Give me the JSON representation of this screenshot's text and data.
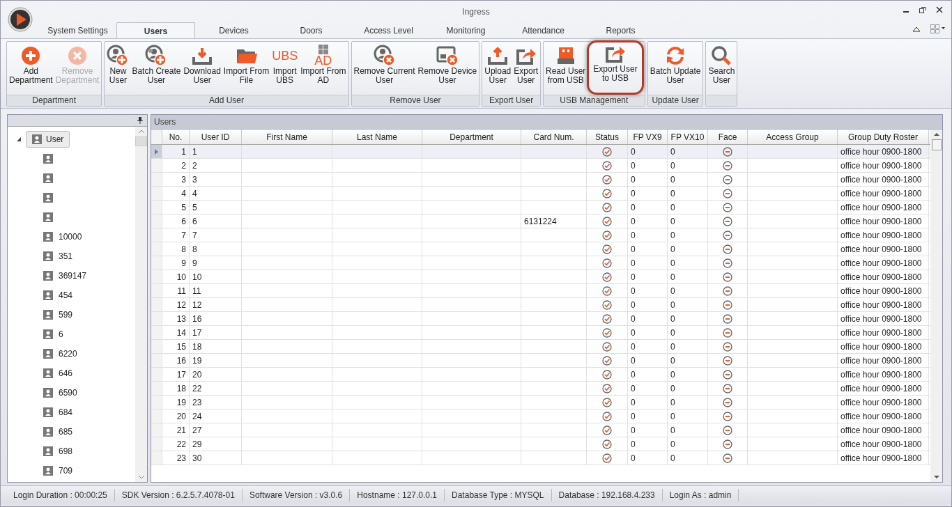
{
  "window": {
    "title": "Ingress"
  },
  "tabs": [
    {
      "label": "System Settings",
      "selected": false
    },
    {
      "label": "Users",
      "selected": true
    },
    {
      "label": "Devices",
      "selected": false
    },
    {
      "label": "Doors",
      "selected": false
    },
    {
      "label": "Access Level",
      "selected": false
    },
    {
      "label": "Monitoring",
      "selected": false
    },
    {
      "label": "Attendance",
      "selected": false
    },
    {
      "label": "Reports",
      "selected": false
    }
  ],
  "ribbon": {
    "groups": [
      {
        "title": "Department",
        "buttons": [
          {
            "label": "Add\nDepartment",
            "kind": "add",
            "disabled": false,
            "highlighted": false
          },
          {
            "label": "Remove\nDepartment",
            "kind": "remove",
            "disabled": true,
            "highlighted": false
          }
        ]
      },
      {
        "title": "Add User",
        "buttons": [
          {
            "label": "New\nUser",
            "kind": "user-add",
            "disabled": false,
            "highlighted": false
          },
          {
            "label": "Batch Create\nUser",
            "kind": "users-add",
            "disabled": false,
            "highlighted": false
          },
          {
            "label": "Download\nUser",
            "kind": "download",
            "disabled": false,
            "highlighted": false
          },
          {
            "label": "Import From\nFile",
            "kind": "folder",
            "disabled": false,
            "highlighted": false
          },
          {
            "label": "Import\nUBS",
            "kind": "text",
            "icon_text": "UBS",
            "disabled": false,
            "highlighted": false
          },
          {
            "label": "Import From\nAD",
            "kind": "windows-text",
            "icon_text": "AD",
            "disabled": false,
            "highlighted": false
          }
        ]
      },
      {
        "title": "Remove User",
        "buttons": [
          {
            "label": "Remove Current\nUser",
            "kind": "user-remove",
            "disabled": false,
            "highlighted": false
          },
          {
            "label": "Remove Device\nUser",
            "kind": "device-remove",
            "disabled": false,
            "highlighted": false
          }
        ]
      },
      {
        "title": "Export User",
        "buttons": [
          {
            "label": "Upload\nUser",
            "kind": "upload",
            "disabled": false,
            "highlighted": false
          },
          {
            "label": "Export\nUser",
            "kind": "export",
            "disabled": false,
            "highlighted": false
          }
        ]
      },
      {
        "title": "USB Management",
        "buttons": [
          {
            "label": "Read User\nfrom USB",
            "kind": "usb",
            "disabled": false,
            "highlighted": false
          },
          {
            "label": "Export User\nto USB",
            "kind": "export",
            "disabled": false,
            "highlighted": true
          }
        ]
      },
      {
        "title": "Update User",
        "buttons": [
          {
            "label": "Batch Update\nUser",
            "kind": "refresh",
            "disabled": false,
            "highlighted": false
          }
        ]
      },
      {
        "buttons": [
          {
            "label": "Search\nUser",
            "kind": "search",
            "disabled": false,
            "highlighted": false
          }
        ]
      }
    ]
  },
  "tree": {
    "label": "User",
    "expanded": true,
    "selected": true,
    "children": [
      {
        "kind": "user"
      },
      {
        "kind": "user"
      },
      {
        "kind": "user"
      },
      {
        "kind": "user"
      },
      {
        "kind": "user",
        "label": "10000"
      },
      {
        "kind": "user",
        "label": "351"
      },
      {
        "kind": "user",
        "label": "369147"
      },
      {
        "kind": "user",
        "label": "454"
      },
      {
        "kind": "user",
        "label": "599"
      },
      {
        "kind": "user",
        "label": "6"
      },
      {
        "kind": "user",
        "label": "6220"
      },
      {
        "kind": "user",
        "label": "646"
      },
      {
        "kind": "user",
        "label": "6590"
      },
      {
        "kind": "user",
        "label": "684"
      },
      {
        "kind": "user",
        "label": "685"
      },
      {
        "kind": "user",
        "label": "698"
      },
      {
        "kind": "user",
        "label": "709"
      }
    ]
  },
  "grid": {
    "title": "Users",
    "columns": [
      "No.",
      "User ID",
      "First Name",
      "Last Name",
      "Department",
      "Card Num.",
      "Status",
      "FP VX9",
      "FP VX10",
      "Face",
      "Access Group",
      "Group Duty Roster"
    ],
    "rows": [
      {
        "no": "1",
        "user_id": "1",
        "status_ok": true,
        "fp_vx9": "0",
        "fp_vx10": "0",
        "face_enrolled": false,
        "roster": "office hour 0900-1800",
        "selected": true
      },
      {
        "no": "2",
        "user_id": "2",
        "status_ok": true,
        "fp_vx9": "0",
        "fp_vx10": "0",
        "face_enrolled": false,
        "roster": "office hour 0900-1800",
        "selected": false
      },
      {
        "no": "3",
        "user_id": "3",
        "status_ok": true,
        "fp_vx9": "0",
        "fp_vx10": "0",
        "face_enrolled": false,
        "roster": "office hour 0900-1800",
        "selected": false
      },
      {
        "no": "4",
        "user_id": "4",
        "status_ok": true,
        "fp_vx9": "0",
        "fp_vx10": "0",
        "face_enrolled": false,
        "roster": "office hour 0900-1800",
        "selected": false
      },
      {
        "no": "5",
        "user_id": "5",
        "status_ok": true,
        "fp_vx9": "0",
        "fp_vx10": "0",
        "face_enrolled": false,
        "roster": "office hour 0900-1800",
        "selected": false
      },
      {
        "no": "6",
        "user_id": "6",
        "card": "6131224",
        "status_ok": true,
        "fp_vx9": "0",
        "fp_vx10": "0",
        "face_enrolled": false,
        "roster": "office hour 0900-1800",
        "selected": false
      },
      {
        "no": "7",
        "user_id": "7",
        "status_ok": true,
        "fp_vx9": "0",
        "fp_vx10": "0",
        "face_enrolled": false,
        "roster": "office hour 0900-1800",
        "selected": false
      },
      {
        "no": "8",
        "user_id": "8",
        "status_ok": true,
        "fp_vx9": "0",
        "fp_vx10": "0",
        "face_enrolled": false,
        "roster": "office hour 0900-1800",
        "selected": false
      },
      {
        "no": "9",
        "user_id": "9",
        "status_ok": true,
        "fp_vx9": "0",
        "fp_vx10": "0",
        "face_enrolled": false,
        "roster": "office hour 0900-1800",
        "selected": false
      },
      {
        "no": "10",
        "user_id": "10",
        "status_ok": true,
        "fp_vx9": "0",
        "fp_vx10": "0",
        "face_enrolled": false,
        "roster": "office hour 0900-1800",
        "selected": false
      },
      {
        "no": "11",
        "user_id": "11",
        "status_ok": true,
        "fp_vx9": "0",
        "fp_vx10": "0",
        "face_enrolled": false,
        "roster": "office hour 0900-1800",
        "selected": false
      },
      {
        "no": "12",
        "user_id": "12",
        "status_ok": true,
        "fp_vx9": "0",
        "fp_vx10": "0",
        "face_enrolled": false,
        "roster": "office hour 0900-1800",
        "selected": false
      },
      {
        "no": "13",
        "user_id": "16",
        "status_ok": true,
        "fp_vx9": "0",
        "fp_vx10": "0",
        "face_enrolled": false,
        "roster": "office hour 0900-1800",
        "selected": false
      },
      {
        "no": "14",
        "user_id": "17",
        "status_ok": true,
        "fp_vx9": "0",
        "fp_vx10": "0",
        "face_enrolled": false,
        "roster": "office hour 0900-1800",
        "selected": false
      },
      {
        "no": "15",
        "user_id": "18",
        "status_ok": true,
        "fp_vx9": "0",
        "fp_vx10": "0",
        "face_enrolled": false,
        "roster": "office hour 0900-1800",
        "selected": false
      },
      {
        "no": "16",
        "user_id": "19",
        "status_ok": true,
        "fp_vx9": "0",
        "fp_vx10": "0",
        "face_enrolled": false,
        "roster": "office hour 0900-1800",
        "selected": false
      },
      {
        "no": "17",
        "user_id": "20",
        "status_ok": true,
        "fp_vx9": "0",
        "fp_vx10": "0",
        "face_enrolled": false,
        "roster": "office hour 0900-1800",
        "selected": false
      },
      {
        "no": "18",
        "user_id": "22",
        "status_ok": true,
        "fp_vx9": "0",
        "fp_vx10": "0",
        "face_enrolled": false,
        "roster": "office hour 0900-1800",
        "selected": false
      },
      {
        "no": "19",
        "user_id": "23",
        "status_ok": true,
        "fp_vx9": "0",
        "fp_vx10": "0",
        "face_enrolled": false,
        "roster": "office hour 0900-1800",
        "selected": false
      },
      {
        "no": "20",
        "user_id": "24",
        "status_ok": true,
        "fp_vx9": "0",
        "fp_vx10": "0",
        "face_enrolled": false,
        "roster": "office hour 0900-1800",
        "selected": false
      },
      {
        "no": "21",
        "user_id": "27",
        "status_ok": true,
        "fp_vx9": "0",
        "fp_vx10": "0",
        "face_enrolled": false,
        "roster": "office hour 0900-1800",
        "selected": false
      },
      {
        "no": "22",
        "user_id": "29",
        "status_ok": true,
        "fp_vx9": "0",
        "fp_vx10": "0",
        "face_enrolled": false,
        "roster": "office hour 0900-1800",
        "selected": false
      },
      {
        "no": "23",
        "user_id": "30",
        "status_ok": true,
        "fp_vx9": "0",
        "fp_vx10": "0",
        "face_enrolled": false,
        "roster": "office hour 0900-1800",
        "selected": false
      }
    ]
  },
  "status_bar": [
    "Login Duration : 00:00:25",
    "SDK Version : 6.2.5.7.4078-01",
    "Software Version : v3.0.6",
    "Hostname : 127.0.0.1",
    "Database Type : MYSQL",
    "Database : 192.168.4.233",
    "Login As : admin"
  ]
}
